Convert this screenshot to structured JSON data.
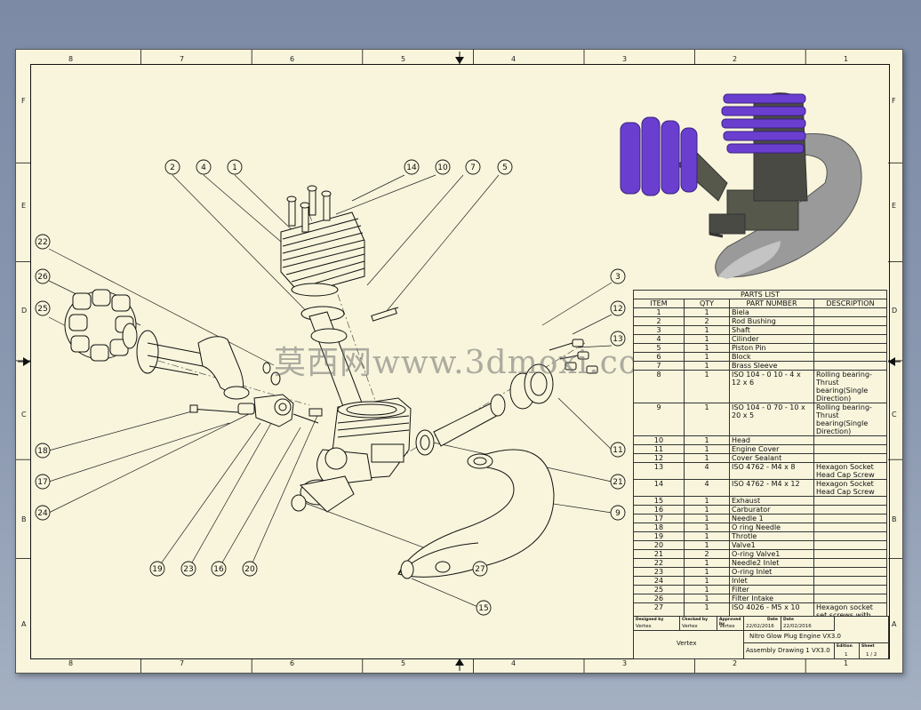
{
  "zones": {
    "top": [
      "8",
      "7",
      "6",
      "5",
      "4",
      "3",
      "2",
      "1"
    ],
    "bottom": [
      "8",
      "7",
      "6",
      "5",
      "4",
      "3",
      "2",
      "1"
    ],
    "left": [
      "F",
      "E",
      "D",
      "C",
      "B",
      "A"
    ],
    "right": [
      "F",
      "E",
      "D",
      "C",
      "B",
      "A"
    ]
  },
  "balloons": [
    "2",
    "4",
    "1",
    "14",
    "10",
    "7",
    "5",
    "22",
    "26",
    "25",
    "3",
    "12",
    "13",
    "11",
    "21",
    "9",
    "18",
    "17",
    "24",
    "19",
    "23",
    "16",
    "20",
    "27",
    "15"
  ],
  "parts_list": {
    "title": "PARTS LIST",
    "headers": [
      "ITEM",
      "QTY",
      "PART NUMBER",
      "DESCRIPTION"
    ],
    "rows": [
      {
        "item": "1",
        "qty": "1",
        "part": "Biela",
        "desc": ""
      },
      {
        "item": "2",
        "qty": "2",
        "part": "Rod Bushing",
        "desc": ""
      },
      {
        "item": "3",
        "qty": "1",
        "part": "Shaft",
        "desc": ""
      },
      {
        "item": "4",
        "qty": "1",
        "part": "Cilinder",
        "desc": ""
      },
      {
        "item": "5",
        "qty": "1",
        "part": "Piston Pin",
        "desc": ""
      },
      {
        "item": "6",
        "qty": "1",
        "part": "Block",
        "desc": ""
      },
      {
        "item": "7",
        "qty": "1",
        "part": "Brass Sleeve",
        "desc": ""
      },
      {
        "item": "8",
        "qty": "1",
        "part": "ISO 104 - 0 10 - 4 x 12 x 6",
        "desc": "Rolling bearing-Thrust bearing(Single Direction)"
      },
      {
        "item": "9",
        "qty": "1",
        "part": "ISO 104 - 0 70 - 10 x 20 x 5",
        "desc": "Rolling bearing-Thrust bearing(Single Direction)"
      },
      {
        "item": "10",
        "qty": "1",
        "part": "Head",
        "desc": ""
      },
      {
        "item": "11",
        "qty": "1",
        "part": "Engine Cover",
        "desc": ""
      },
      {
        "item": "12",
        "qty": "1",
        "part": "Cover Sealant",
        "desc": ""
      },
      {
        "item": "13",
        "qty": "4",
        "part": "ISO 4762 - M4 x 8",
        "desc": "Hexagon Socket Head Cap Screw"
      },
      {
        "item": "14",
        "qty": "4",
        "part": "ISO 4762 - M4 x 12",
        "desc": "Hexagon Socket Head Cap Screw"
      },
      {
        "item": "15",
        "qty": "1",
        "part": "Exhaust",
        "desc": ""
      },
      {
        "item": "16",
        "qty": "1",
        "part": "Carburator",
        "desc": ""
      },
      {
        "item": "17",
        "qty": "1",
        "part": "Needle 1",
        "desc": ""
      },
      {
        "item": "18",
        "qty": "1",
        "part": "O ring Needle",
        "desc": ""
      },
      {
        "item": "19",
        "qty": "1",
        "part": "Throtle",
        "desc": ""
      },
      {
        "item": "20",
        "qty": "1",
        "part": "Valve1",
        "desc": ""
      },
      {
        "item": "21",
        "qty": "2",
        "part": "O-ring Valve1",
        "desc": ""
      },
      {
        "item": "22",
        "qty": "1",
        "part": "Needle2 Inlet",
        "desc": ""
      },
      {
        "item": "23",
        "qty": "1",
        "part": "O-ring Inlet",
        "desc": ""
      },
      {
        "item": "24",
        "qty": "1",
        "part": "Inlet",
        "desc": ""
      },
      {
        "item": "25",
        "qty": "1",
        "part": "Filter",
        "desc": ""
      },
      {
        "item": "26",
        "qty": "1",
        "part": "Filter Intake",
        "desc": ""
      },
      {
        "item": "27",
        "qty": "1",
        "part": "ISO 4026 - M5 x 10",
        "desc": "Hexagon socket set screws with flat point"
      }
    ]
  },
  "title_block": {
    "designed_by_label": "Designed by",
    "designed_by": "Vertex",
    "checked_by_label": "Checked by",
    "checked_by": "Vertex",
    "approved_by_label": "Approved by",
    "approved_by": "Vertex",
    "date_label": "Date",
    "date1": "22/02/2016",
    "date2_label": "Date",
    "date2": "22/02/2016",
    "company": "Vertex",
    "title": "Nitro Glow Plug Engine VX3.0",
    "subtitle": "Assembly Drawing 1 VX3.0",
    "edition_label": "Edition",
    "edition": "1",
    "sheet_label": "Sheet",
    "sheet": "1 / 2"
  },
  "watermark": "莫西网www.3dmoxi.com",
  "colors": {
    "sheet": "#f8f5dc",
    "line": "#111111",
    "render_purple": "#6a3fd0",
    "render_grey": "#5a5a4e",
    "background": "#8a98b0"
  }
}
